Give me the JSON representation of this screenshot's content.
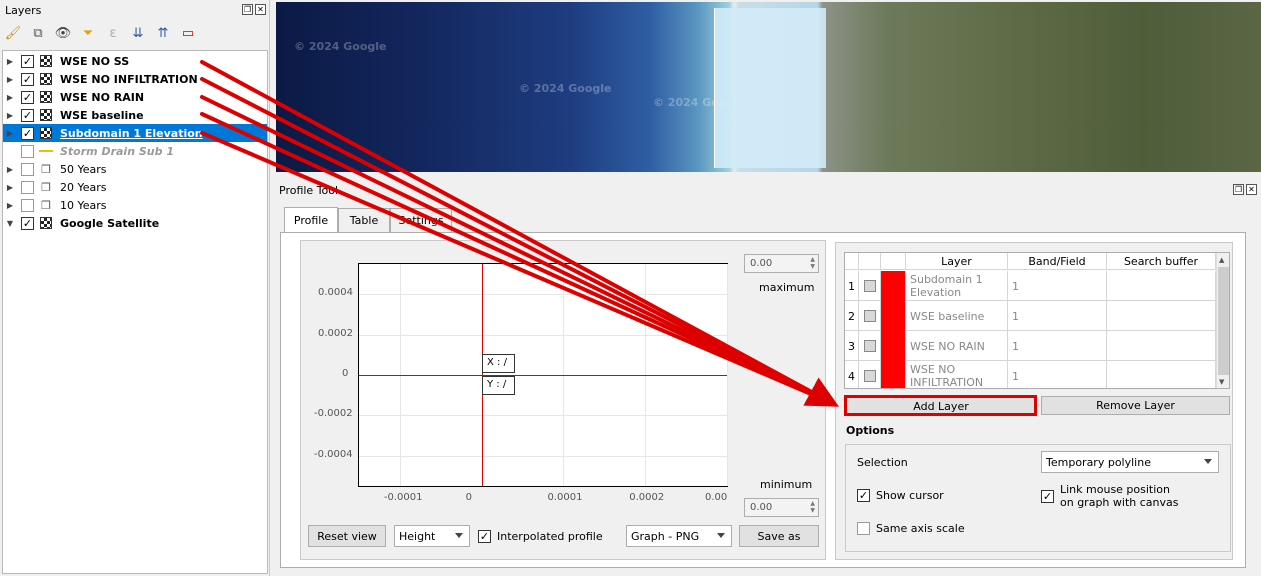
{
  "layers_panel": {
    "title": "Layers",
    "toolbar_icons": [
      "style-brush-icon",
      "add-group-icon",
      "visibility-eye-icon",
      "filter-icon",
      "expression-filter-icon",
      "expand-all-icon",
      "collapse-all-icon",
      "remove-layer-icon"
    ],
    "layers": [
      {
        "name": "WSE NO SS",
        "checked": true,
        "icon": "raster-icon",
        "bold": true
      },
      {
        "name": "WSE NO INFILTRATION",
        "checked": true,
        "icon": "raster-icon",
        "bold": true
      },
      {
        "name": "WSE NO RAIN",
        "checked": true,
        "icon": "raster-icon",
        "bold": true
      },
      {
        "name": "WSE baseline",
        "checked": true,
        "icon": "raster-icon",
        "bold": true
      },
      {
        "name": "Subdomain 1 Elevation",
        "checked": true,
        "icon": "raster-icon",
        "bold": true,
        "selected": true
      },
      {
        "name": "Storm Drain Sub 1",
        "checked": false,
        "icon": "line-icon"
      },
      {
        "name": "50 Years",
        "checked": false,
        "icon": "group-icon"
      },
      {
        "name": "20 Years",
        "checked": false,
        "icon": "group-icon"
      },
      {
        "name": "10 Years",
        "checked": false,
        "icon": "group-icon"
      },
      {
        "name": "Google Satellite",
        "checked": true,
        "icon": "raster-icon",
        "bold": true
      }
    ]
  },
  "map": {
    "watermarks": [
      "© 2024 Google",
      "© 2024 Google",
      "© 2024 Google"
    ]
  },
  "profile_tool": {
    "title": "Profile Tool",
    "tabs": [
      "Profile",
      "Table",
      "Settings"
    ],
    "active_tab": "Profile",
    "max_value": "0.00",
    "max_label": "maximum",
    "min_value": "0.00",
    "min_label": "minimum",
    "tooltip_x": "X : /",
    "tooltip_y": "Y : /",
    "buttons": {
      "reset": "Reset view",
      "save": "Save as",
      "add": "Add Layer",
      "remove": "Remove Layer"
    },
    "height_combo": "Height",
    "interpolated": {
      "label": "Interpolated profile",
      "checked": true
    },
    "export_combo": "Graph - PNG"
  },
  "chart_data": {
    "type": "line",
    "title": "",
    "xlabel": "",
    "ylabel": "",
    "xlim": [
      -0.00015,
      0.0003
    ],
    "ylim": [
      -0.00055,
      0.00055
    ],
    "x_ticks": [
      "-0.0001",
      "0",
      "0.0001",
      "0.0002",
      "0.00"
    ],
    "y_ticks": [
      "0.0004",
      "0.0002",
      "0",
      "-0.0002",
      "-0.0004"
    ],
    "series": [],
    "grid": true,
    "cursor": {
      "x": 0,
      "y": 0
    }
  },
  "layer_table": {
    "headers": [
      "",
      "",
      "Layer",
      "Band/Field",
      "Search buffer"
    ],
    "rows": [
      {
        "n": "1",
        "layer": "Subdomain 1 Elevation",
        "band": "1",
        "buffer": ""
      },
      {
        "n": "2",
        "layer": "WSE baseline",
        "band": "1",
        "buffer": ""
      },
      {
        "n": "3",
        "layer": "WSE NO RAIN",
        "band": "1",
        "buffer": ""
      },
      {
        "n": "4",
        "layer": "WSE NO INFILTRATION",
        "band": "1",
        "buffer": ""
      }
    ]
  },
  "options": {
    "title": "Options",
    "selection_label": "Selection",
    "selection_value": "Temporary polyline",
    "show_cursor": {
      "label": "Show cursor",
      "checked": true
    },
    "link_mouse": {
      "label": "Link mouse position on graph with canvas",
      "checked": true
    },
    "same_axis": {
      "label": "Same axis scale",
      "checked": false
    }
  },
  "colors": {
    "highlight": "#0078d7",
    "annotation": "#dd0000",
    "layer_color": "#ff0000"
  }
}
